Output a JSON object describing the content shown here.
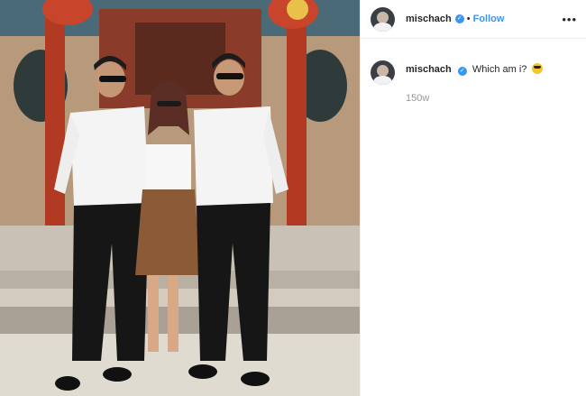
{
  "post": {
    "photo_alt": "",
    "header": {
      "username": "mischach",
      "verified_mark": "✓",
      "separator": "•",
      "follow_label": "Follow",
      "more_label": "•••"
    },
    "caption": {
      "username": "mischach",
      "verified_mark": "✓",
      "text": "Which am i?",
      "emoji": "sunglasses-emoji",
      "time_ago": "150w"
    }
  },
  "colors": {
    "link_blue": "#3897f0",
    "text": "#262626",
    "muted": "#999999",
    "divider": "#efefef"
  }
}
